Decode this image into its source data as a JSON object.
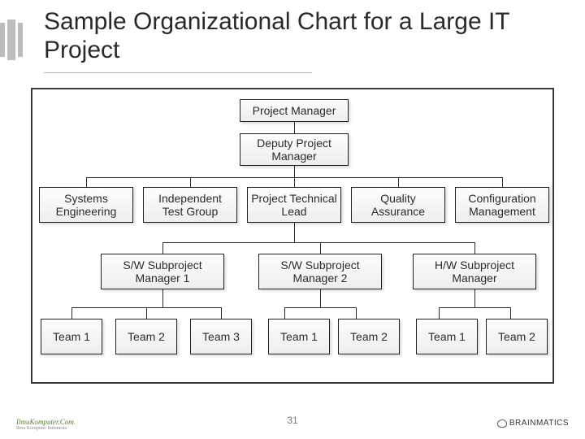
{
  "title": "Sample Organizational Chart for a Large IT Project",
  "page_number": "31",
  "footer": {
    "left": "IlmuKomputer.Com",
    "left_sub": "Ilmu Komputer Indonesia",
    "right": "BRAINMATICS"
  },
  "chart_data": {
    "type": "tree",
    "root": "Project Manager",
    "nodes": {
      "pm": "Project Manager",
      "dpm": "Deputy Project Manager",
      "se": "Systems Engineering",
      "itg": "Independent Test Group",
      "ptl": "Project Technical Lead",
      "qa": "Quality Assurance",
      "cm": "Configuration Management",
      "sw1": "S/W Subproject Manager 1",
      "sw2": "S/W Subproject Manager 2",
      "hw": "H/W Subproject Manager",
      "sw1_t1": "Team 1",
      "sw1_t2": "Team 2",
      "sw1_t3": "Team 3",
      "sw2_t1": "Team 1",
      "sw2_t2": "Team 2",
      "hw_t1": "Team 1",
      "hw_t2": "Team 2"
    },
    "edges": [
      [
        "pm",
        "dpm"
      ],
      [
        "dpm",
        "se"
      ],
      [
        "dpm",
        "itg"
      ],
      [
        "dpm",
        "ptl"
      ],
      [
        "dpm",
        "qa"
      ],
      [
        "dpm",
        "cm"
      ],
      [
        "ptl",
        "sw1"
      ],
      [
        "ptl",
        "sw2"
      ],
      [
        "ptl",
        "hw"
      ],
      [
        "sw1",
        "sw1_t1"
      ],
      [
        "sw1",
        "sw1_t2"
      ],
      [
        "sw1",
        "sw1_t3"
      ],
      [
        "sw2",
        "sw2_t1"
      ],
      [
        "sw2",
        "sw2_t2"
      ],
      [
        "hw",
        "hw_t1"
      ],
      [
        "hw",
        "hw_t2"
      ]
    ]
  }
}
